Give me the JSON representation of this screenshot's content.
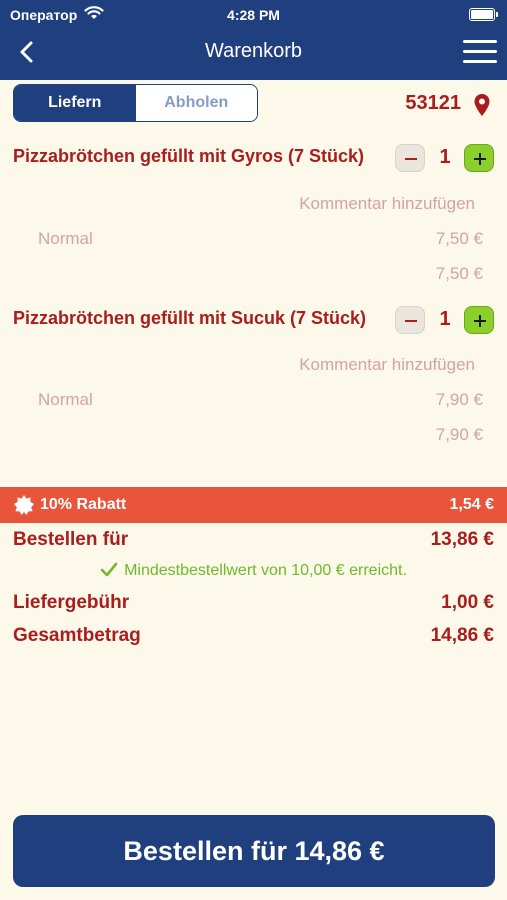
{
  "status_bar": {
    "carrier": "Оператор",
    "time": "4:28 PM"
  },
  "header": {
    "title": "Warenkorb"
  },
  "delivery_toggle": {
    "deliver": "Liefern",
    "pickup": "Abholen"
  },
  "location": {
    "zip": "53121"
  },
  "items": [
    {
      "name": "Pizzabrötchen gefüllt mit Gyros (7 Stück)",
      "quantity": "1",
      "comment": "Kommentar hinzufügen",
      "variant": "Normal",
      "variant_price": "7,50 €",
      "total": "7,50 €"
    },
    {
      "name": "Pizzabrötchen gefüllt mit Sucuk (7 Stück)",
      "quantity": "1",
      "comment": "Kommentar hinzufügen",
      "variant": "Normal",
      "variant_price": "7,90 €",
      "total": "7,90 €"
    }
  ],
  "discount": {
    "label": "10% Rabatt",
    "amount": "1,54 €"
  },
  "summary": {
    "order_for_label": "Bestellen für",
    "order_for_value": "13,86 €",
    "min_order_msg": "Mindestbestellwert von 10,00 € erreicht.",
    "delivery_fee_label": "Liefergebühr",
    "delivery_fee_value": "1,00 €",
    "total_label": "Gesamtbetrag",
    "total_value": "14,86 €"
  },
  "order_button": {
    "label": "Bestellen für 14,86 €"
  },
  "colors": {
    "navy": "#1f3f7f",
    "red": "#a91d1d",
    "discount": "#e8553b",
    "green": "#8ccf2b",
    "background": "#fcf8ea"
  }
}
